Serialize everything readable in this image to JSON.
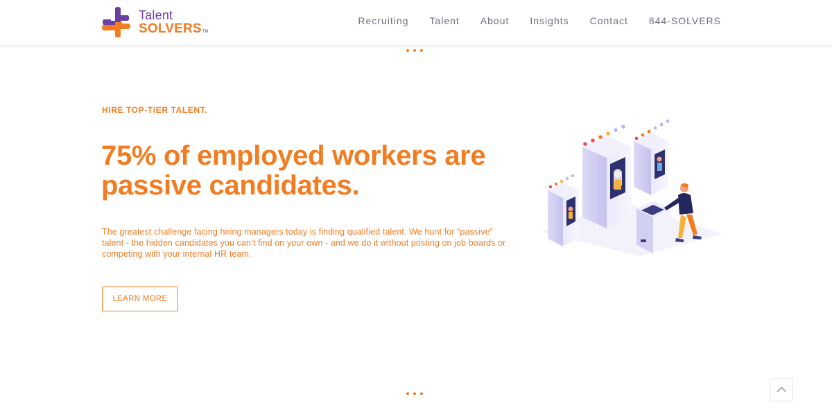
{
  "brand": {
    "name_line1": "Talent",
    "name_line2": "SOLVERS",
    "trademark": "TM",
    "logo_icon": "cross-logo-icon",
    "colors": {
      "primary": "#f27c22",
      "secondary": "#6b3fa0",
      "nav_text": "#6c6c80"
    }
  },
  "nav": {
    "items": [
      {
        "label": "Recruiting"
      },
      {
        "label": "Talent"
      },
      {
        "label": "About"
      },
      {
        "label": "Insights"
      },
      {
        "label": "Contact"
      },
      {
        "label": "844-SOLVERS"
      }
    ]
  },
  "hero": {
    "eyebrow": "HIRE TOP-TIER TALENT.",
    "headline_line1": "75% of employed workers are",
    "headline_line2": "passive candidates.",
    "body": "The greatest challenge facing hiring managers today is finding qualified talent. We hunt for “passive” talent - the hidden candidates you can’t find on your own - and we do it without posting on job boards or competing with your internal HR team.",
    "cta_label": "LEARN MORE",
    "illustration_icon": "candidate-selection-illustration"
  },
  "scroll_top": {
    "icon": "chevron-up-icon"
  }
}
